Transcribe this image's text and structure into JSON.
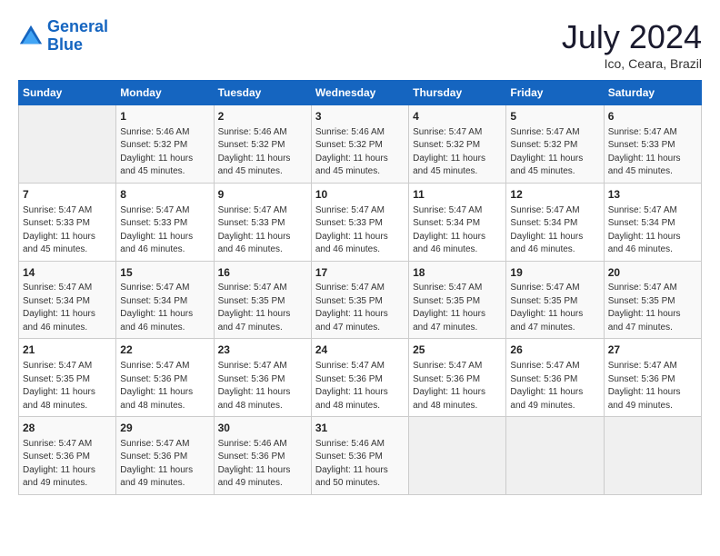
{
  "header": {
    "logo_line1": "General",
    "logo_line2": "Blue",
    "title": "July 2024",
    "location": "Ico, Ceara, Brazil"
  },
  "weekdays": [
    "Sunday",
    "Monday",
    "Tuesday",
    "Wednesday",
    "Thursday",
    "Friday",
    "Saturday"
  ],
  "weeks": [
    [
      {
        "day": "",
        "info": ""
      },
      {
        "day": "1",
        "info": "Sunrise: 5:46 AM\nSunset: 5:32 PM\nDaylight: 11 hours\nand 45 minutes."
      },
      {
        "day": "2",
        "info": "Sunrise: 5:46 AM\nSunset: 5:32 PM\nDaylight: 11 hours\nand 45 minutes."
      },
      {
        "day": "3",
        "info": "Sunrise: 5:46 AM\nSunset: 5:32 PM\nDaylight: 11 hours\nand 45 minutes."
      },
      {
        "day": "4",
        "info": "Sunrise: 5:47 AM\nSunset: 5:32 PM\nDaylight: 11 hours\nand 45 minutes."
      },
      {
        "day": "5",
        "info": "Sunrise: 5:47 AM\nSunset: 5:32 PM\nDaylight: 11 hours\nand 45 minutes."
      },
      {
        "day": "6",
        "info": "Sunrise: 5:47 AM\nSunset: 5:33 PM\nDaylight: 11 hours\nand 45 minutes."
      }
    ],
    [
      {
        "day": "7",
        "info": "Sunrise: 5:47 AM\nSunset: 5:33 PM\nDaylight: 11 hours\nand 45 minutes."
      },
      {
        "day": "8",
        "info": "Sunrise: 5:47 AM\nSunset: 5:33 PM\nDaylight: 11 hours\nand 46 minutes."
      },
      {
        "day": "9",
        "info": "Sunrise: 5:47 AM\nSunset: 5:33 PM\nDaylight: 11 hours\nand 46 minutes."
      },
      {
        "day": "10",
        "info": "Sunrise: 5:47 AM\nSunset: 5:33 PM\nDaylight: 11 hours\nand 46 minutes."
      },
      {
        "day": "11",
        "info": "Sunrise: 5:47 AM\nSunset: 5:34 PM\nDaylight: 11 hours\nand 46 minutes."
      },
      {
        "day": "12",
        "info": "Sunrise: 5:47 AM\nSunset: 5:34 PM\nDaylight: 11 hours\nand 46 minutes."
      },
      {
        "day": "13",
        "info": "Sunrise: 5:47 AM\nSunset: 5:34 PM\nDaylight: 11 hours\nand 46 minutes."
      }
    ],
    [
      {
        "day": "14",
        "info": "Sunrise: 5:47 AM\nSunset: 5:34 PM\nDaylight: 11 hours\nand 46 minutes."
      },
      {
        "day": "15",
        "info": "Sunrise: 5:47 AM\nSunset: 5:34 PM\nDaylight: 11 hours\nand 46 minutes."
      },
      {
        "day": "16",
        "info": "Sunrise: 5:47 AM\nSunset: 5:35 PM\nDaylight: 11 hours\nand 47 minutes."
      },
      {
        "day": "17",
        "info": "Sunrise: 5:47 AM\nSunset: 5:35 PM\nDaylight: 11 hours\nand 47 minutes."
      },
      {
        "day": "18",
        "info": "Sunrise: 5:47 AM\nSunset: 5:35 PM\nDaylight: 11 hours\nand 47 minutes."
      },
      {
        "day": "19",
        "info": "Sunrise: 5:47 AM\nSunset: 5:35 PM\nDaylight: 11 hours\nand 47 minutes."
      },
      {
        "day": "20",
        "info": "Sunrise: 5:47 AM\nSunset: 5:35 PM\nDaylight: 11 hours\nand 47 minutes."
      }
    ],
    [
      {
        "day": "21",
        "info": "Sunrise: 5:47 AM\nSunset: 5:35 PM\nDaylight: 11 hours\nand 48 minutes."
      },
      {
        "day": "22",
        "info": "Sunrise: 5:47 AM\nSunset: 5:36 PM\nDaylight: 11 hours\nand 48 minutes."
      },
      {
        "day": "23",
        "info": "Sunrise: 5:47 AM\nSunset: 5:36 PM\nDaylight: 11 hours\nand 48 minutes."
      },
      {
        "day": "24",
        "info": "Sunrise: 5:47 AM\nSunset: 5:36 PM\nDaylight: 11 hours\nand 48 minutes."
      },
      {
        "day": "25",
        "info": "Sunrise: 5:47 AM\nSunset: 5:36 PM\nDaylight: 11 hours\nand 48 minutes."
      },
      {
        "day": "26",
        "info": "Sunrise: 5:47 AM\nSunset: 5:36 PM\nDaylight: 11 hours\nand 49 minutes."
      },
      {
        "day": "27",
        "info": "Sunrise: 5:47 AM\nSunset: 5:36 PM\nDaylight: 11 hours\nand 49 minutes."
      }
    ],
    [
      {
        "day": "28",
        "info": "Sunrise: 5:47 AM\nSunset: 5:36 PM\nDaylight: 11 hours\nand 49 minutes."
      },
      {
        "day": "29",
        "info": "Sunrise: 5:47 AM\nSunset: 5:36 PM\nDaylight: 11 hours\nand 49 minutes."
      },
      {
        "day": "30",
        "info": "Sunrise: 5:46 AM\nSunset: 5:36 PM\nDaylight: 11 hours\nand 49 minutes."
      },
      {
        "day": "31",
        "info": "Sunrise: 5:46 AM\nSunset: 5:36 PM\nDaylight: 11 hours\nand 50 minutes."
      },
      {
        "day": "",
        "info": ""
      },
      {
        "day": "",
        "info": ""
      },
      {
        "day": "",
        "info": ""
      }
    ]
  ]
}
